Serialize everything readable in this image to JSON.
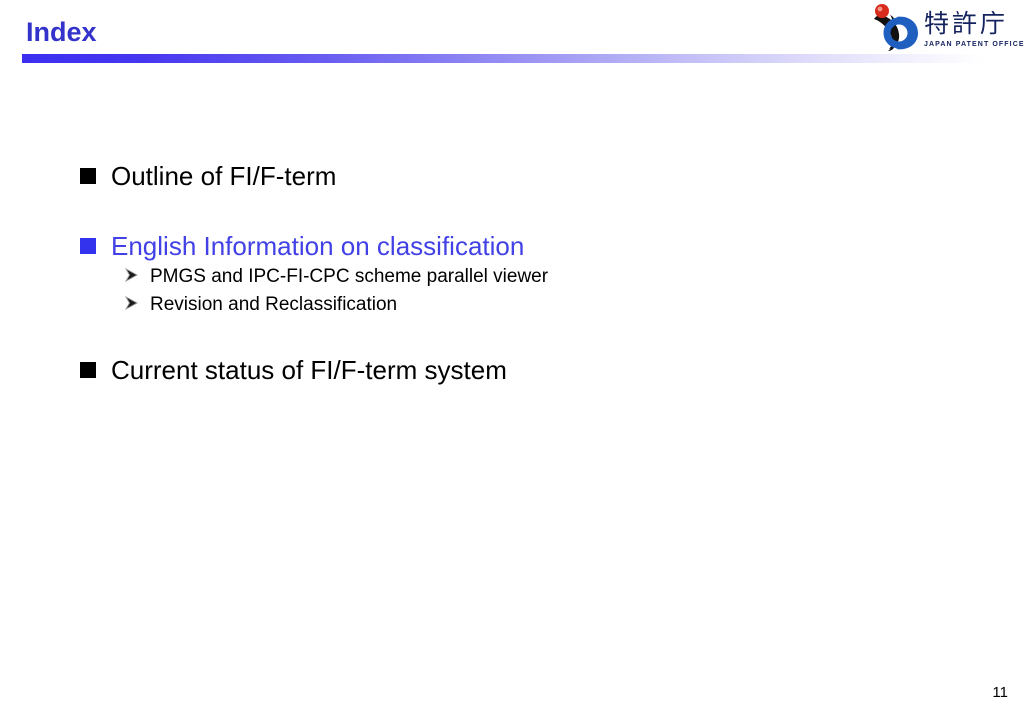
{
  "slide": {
    "title": "Index",
    "page_number": "11",
    "accent_color": "#3333cc",
    "highlight_color": "#4141e6",
    "bullets": [
      {
        "marker": "square-black",
        "text": "Outline of FI/F-term",
        "color": "#000000",
        "subitems": []
      },
      {
        "marker": "square-blue",
        "text": "English Information on classification",
        "color": "#4141e6",
        "subitems": [
          {
            "marker": "arrow",
            "text": "PMGS and IPC-FI-CPC scheme parallel viewer"
          },
          {
            "marker": "arrow",
            "text": "Revision and Reclassification"
          }
        ]
      },
      {
        "marker": "square-black",
        "text": "Current status of FI/F-term system",
        "color": "#000000",
        "subitems": []
      }
    ]
  },
  "logo": {
    "mark_name": "jpo-emblem",
    "kanji": "特許庁",
    "subtitle": "JAPAN PATENT OFFICE",
    "sphere_color": "#d92b1c",
    "swoosh_color": "#111111",
    "ring_color": "#1f5fc0",
    "text_color": "#14225e"
  }
}
